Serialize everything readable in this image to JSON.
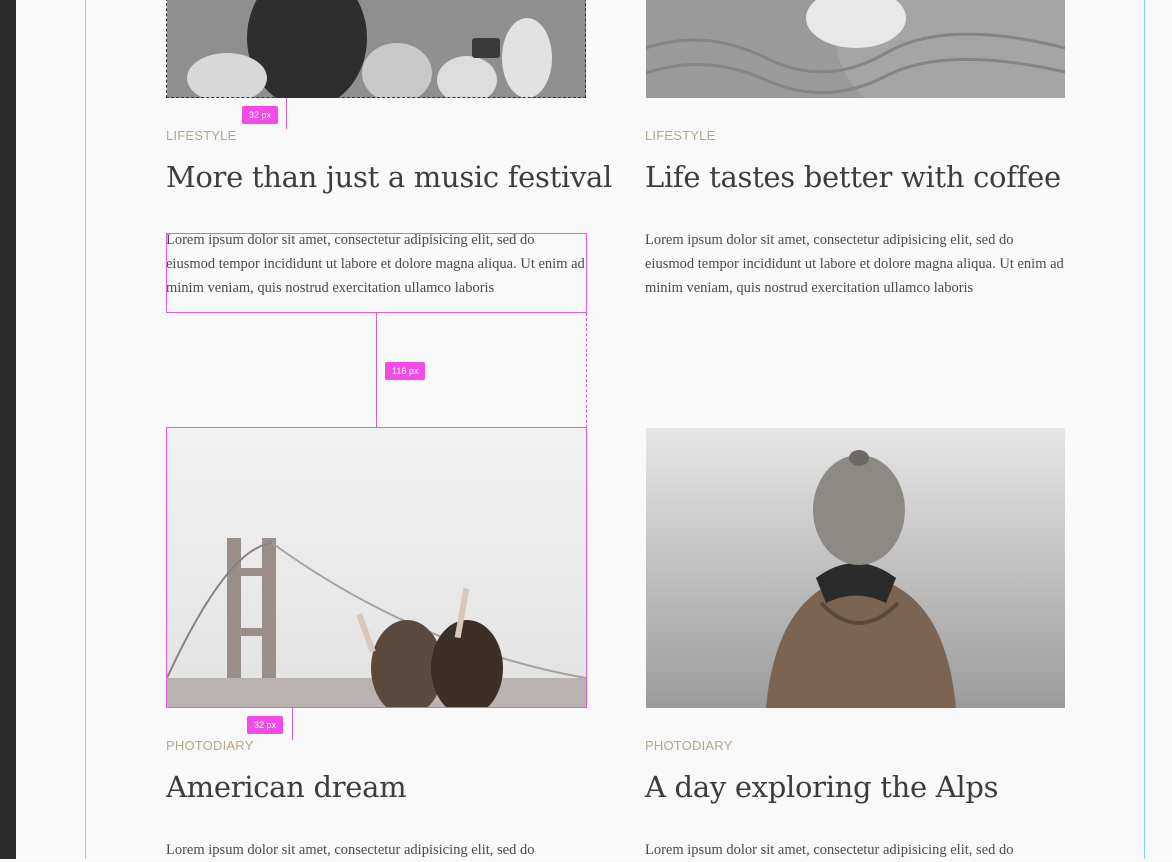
{
  "cards": [
    {
      "category": "LIFESTYLE",
      "title": "More than just a music festival",
      "body": "Lorem ipsum dolor sit amet, consectetur adipisicing elit, sed do eiusmod tempor incididunt ut labore et dolore magna aliqua. Ut enim ad minim veniam, quis nostrud exercitation ullamco laboris"
    },
    {
      "category": "LIFESTYLE",
      "title": "Life tastes better with coffee",
      "body": "Lorem ipsum dolor sit amet, consectetur adipisicing elit, sed do eiusmod tempor incididunt ut labore et dolore magna aliqua. Ut enim ad minim veniam, quis nostrud exercitation ullamco laboris"
    },
    {
      "category": "PHOTODIARY",
      "title": "American dream",
      "body": "Lorem ipsum dolor sit amet, consectetur adipisicing elit, sed do"
    },
    {
      "category": "PHOTODIARY",
      "title": "A day exploring the Alps",
      "body": "Lorem ipsum dolor sit amet, consectetur adipisicing elit, sed do"
    }
  ],
  "measurements": {
    "top_gap": "32 px",
    "middle_gap": "116 px",
    "bottom_gap": "32 px"
  },
  "colors": {
    "category": "#b7a58a",
    "measure": "#f24ce8",
    "guide": "#7fd8ec"
  }
}
